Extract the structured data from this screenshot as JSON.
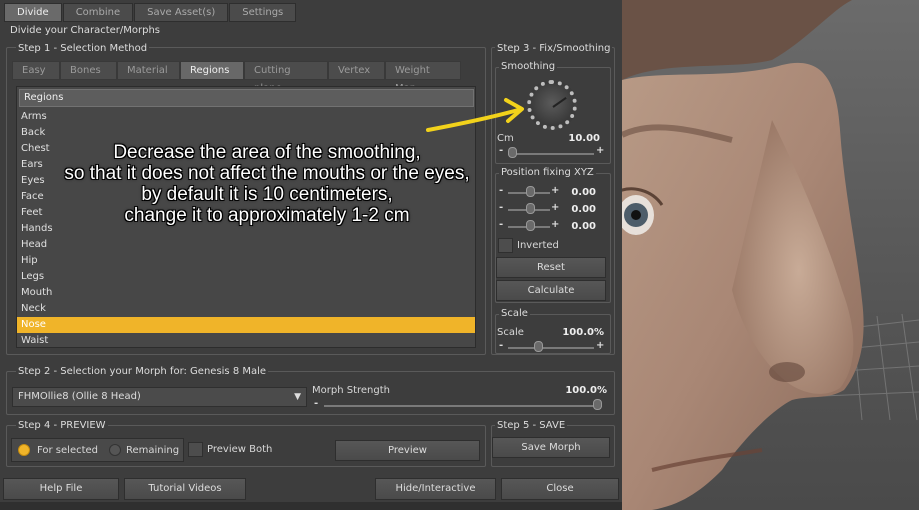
{
  "tabs": [
    "Divide",
    "Combine",
    "Save Asset(s)",
    "Settings"
  ],
  "window_title": "Divide your Character/Morphs",
  "step1": {
    "title": "Step 1 - Selection Method",
    "tabs": [
      "Easy",
      "Bones",
      "Material",
      "Regions",
      "Cutting plane",
      "Vertex",
      "Weight Map"
    ],
    "active_tab": "Regions",
    "list_header": "Regions",
    "items": [
      "Arms",
      "Back",
      "Chest",
      "Ears",
      "Eyes",
      "Face",
      "Feet",
      "Hands",
      "Head",
      "Hip",
      "Legs",
      "Mouth",
      "Neck",
      "Nose",
      "Waist"
    ],
    "selected_item": "Nose"
  },
  "step3": {
    "title": "Step 3 - Fix/Smoothing",
    "smoothing_title": "Smoothing",
    "cm_label": "Cm",
    "cm_value": "10.00",
    "position_title": "Position fixing XYZ",
    "position_values": [
      "0.00",
      "0.00",
      "0.00"
    ],
    "inverted_label": "Inverted",
    "reset_label": "Reset",
    "calculate_label": "Calculate",
    "scale_title": "Scale",
    "scale_label": "Scale",
    "scale_value": "100.0%"
  },
  "step2": {
    "title": "Step 2 - Selection your Morph for: Genesis 8 Male",
    "dropdown_value": "FHMOllie8 (Ollie 8 Head)",
    "strength_label": "Morph Strength",
    "strength_value": "100.0%"
  },
  "step4": {
    "title": "Step 4 - PREVIEW",
    "for_selected": "For selected",
    "remaining": "Remaining",
    "preview_both": "Preview Both",
    "preview_button": "Preview"
  },
  "step5": {
    "title": "Step 5 - SAVE",
    "save_button": "Save Morph"
  },
  "bottom_buttons": [
    "Help File",
    "Tutorial Videos",
    "Hide/Interactive",
    "Close"
  ],
  "annotation": [
    "Decrease the area of the smoothing,",
    "so that it does not affect the mouths or the eyes,",
    "by default it is 10 centimeters,",
    "change it to approximately 1-2 cm"
  ],
  "colors": {
    "accent": "#f0b429",
    "arrow": "#f2d21b",
    "panel_bg": "#3d3d3d"
  },
  "icons": {
    "dial": "smoothing-dial-icon",
    "dropdown": "chevron-down-icon",
    "arrow": "annotation-arrow-icon"
  }
}
